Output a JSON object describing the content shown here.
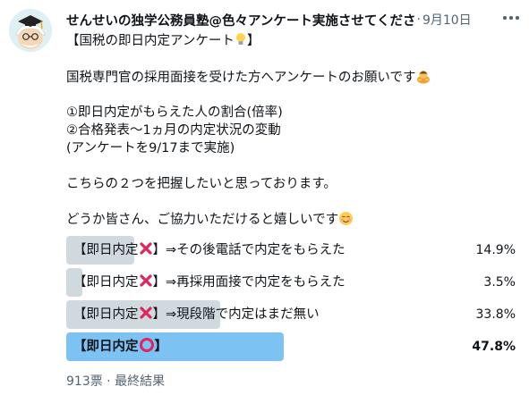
{
  "tweet": {
    "author_name": "せんせいの独学公務員塾@色々アンケート実施させてくださ",
    "separator": "·",
    "date": "9月10日",
    "text": {
      "l1a": "【国税の即日内定アンケート",
      "l1b": "】",
      "l2": "国税専門官の採用面接を受けた方へアンケートのお願いです",
      "l3": "①即日内定がもらえた人の割合(倍率)",
      "l4": "②合格発表〜1ヵ月の内定状況の変動",
      "l5": "(アンケートを9/17まで実施)",
      "l6": "こちらの２つを把握したいと思っております。",
      "l7": "どうか皆さん、ご協力いただけると嬉しいです"
    }
  },
  "poll": {
    "options": [
      {
        "pre": "【即日内定",
        "post": "】⇒その後電話で内定をもらえた",
        "percent": "14.9%",
        "share": 0.149
      },
      {
        "pre": "【即日内定",
        "post": "】⇒再採用面接で内定をもらえた",
        "percent": "3.5%",
        "share": 0.035
      },
      {
        "pre": "【即日内定",
        "post": "】⇒現段階で内定はまだ無い",
        "percent": "33.8%",
        "share": 0.338
      },
      {
        "pre": "【即日内定",
        "post": "】",
        "percent": "47.8%",
        "share": 0.478,
        "winner": true
      }
    ],
    "footer": "913票 · 最終結果"
  },
  "icons": {
    "more": "more-dots-icon",
    "lightbulb": "lightbulb-icon",
    "bow": "bowing-person-emoji",
    "smile": "smiling-face-emoji",
    "cross": "cross-mark-icon",
    "circle": "red-circle-icon"
  },
  "colors": {
    "winner_bar": "#7cc2f2",
    "bar": "#cfd9de",
    "mark_red": "#e0245e"
  }
}
